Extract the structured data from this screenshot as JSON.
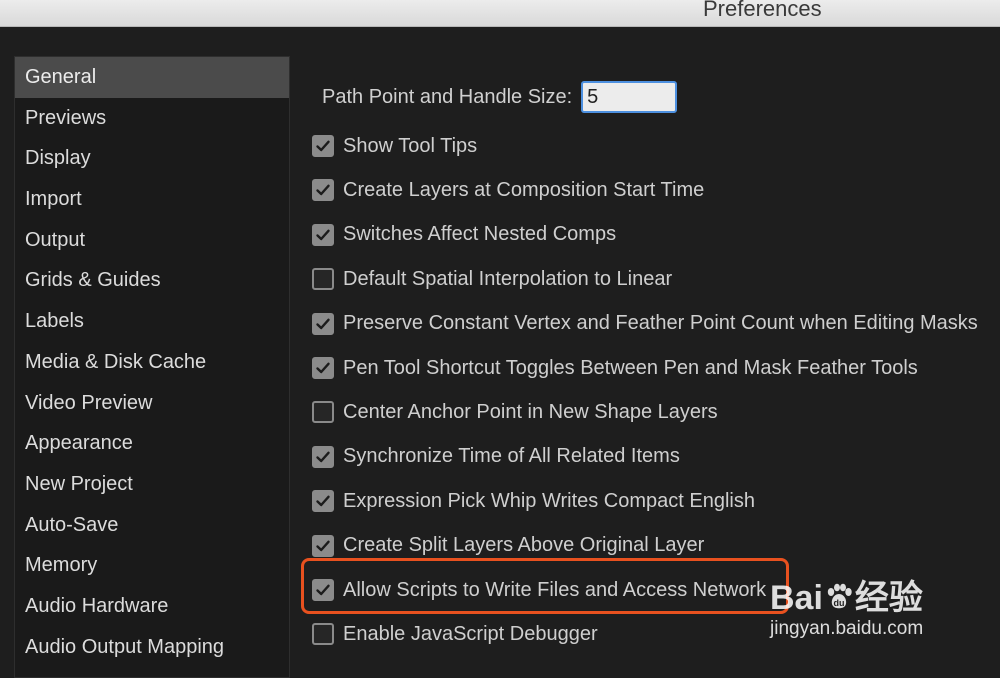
{
  "window": {
    "title": "Preferences"
  },
  "sidebar": {
    "items": [
      {
        "label": "General",
        "selected": true
      },
      {
        "label": "Previews"
      },
      {
        "label": "Display"
      },
      {
        "label": "Import"
      },
      {
        "label": "Output"
      },
      {
        "label": "Grids & Guides"
      },
      {
        "label": "Labels"
      },
      {
        "label": "Media & Disk Cache"
      },
      {
        "label": "Video Preview"
      },
      {
        "label": "Appearance"
      },
      {
        "label": "New Project"
      },
      {
        "label": "Auto-Save"
      },
      {
        "label": "Memory"
      },
      {
        "label": "Audio Hardware"
      },
      {
        "label": "Audio Output Mapping"
      }
    ]
  },
  "general": {
    "path_point_label": "Path Point and Handle Size:",
    "path_point_value": "5",
    "options": [
      {
        "label": "Show Tool Tips",
        "checked": true
      },
      {
        "label": "Create Layers at Composition Start Time",
        "checked": true
      },
      {
        "label": "Switches Affect Nested Comps",
        "checked": true
      },
      {
        "label": "Default Spatial Interpolation to Linear",
        "checked": false
      },
      {
        "label": "Preserve Constant Vertex and Feather Point Count when Editing Masks",
        "checked": true
      },
      {
        "label": "Pen Tool Shortcut Toggles Between Pen and Mask Feather Tools",
        "checked": true
      },
      {
        "label": "Center Anchor Point in New Shape Layers",
        "checked": false
      },
      {
        "label": "Synchronize Time of All Related Items",
        "checked": true
      },
      {
        "label": "Expression Pick Whip Writes Compact English",
        "checked": true
      },
      {
        "label": "Create Split Layers Above Original Layer",
        "checked": true
      },
      {
        "label": "Allow Scripts to Write Files and Access Network",
        "checked": true
      },
      {
        "label": "Enable JavaScript Debugger",
        "checked": false
      }
    ]
  },
  "annotation": {
    "highlight_color": "#e8511f"
  },
  "watermark": {
    "logo_left": "Bai",
    "logo_right": "经验",
    "url": "jingyan.baidu.com"
  }
}
